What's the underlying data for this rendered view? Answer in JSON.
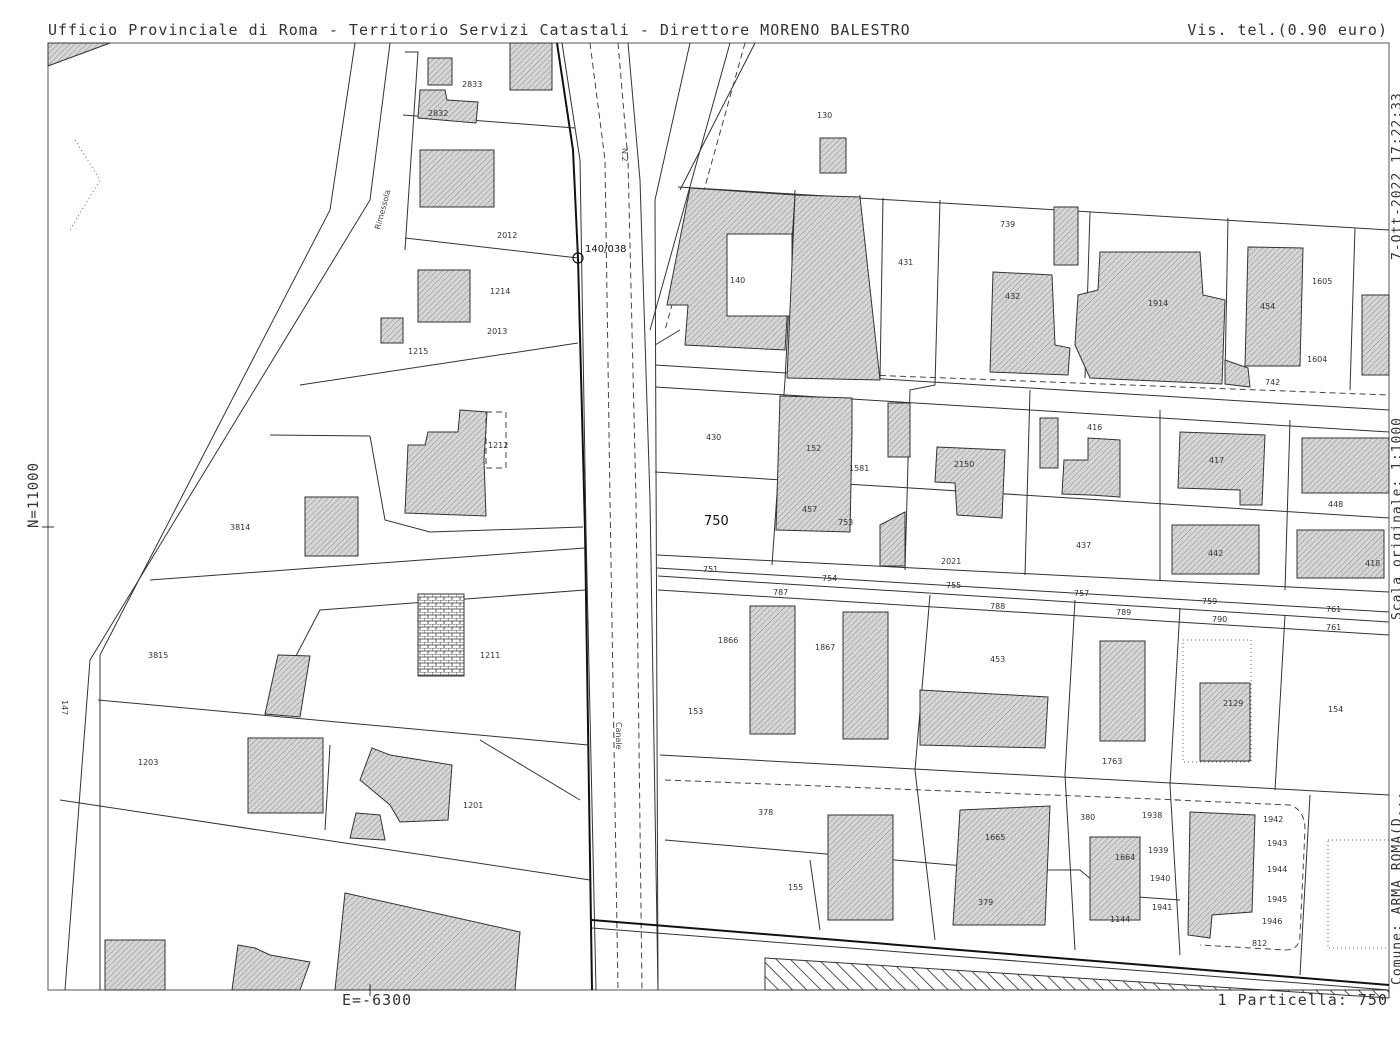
{
  "header": {
    "left": "Ufficio Provinciale di Roma - Territorio Servizi Catastali - Direttore MORENO BALESTRO",
    "right": "Vis. tel.(0.90 euro)"
  },
  "side": {
    "date": "7-Ott-2022 17:22:33",
    "scale": "Scala originale: 1:1000",
    "comune": "Comune: ARMA ROMA(D..."
  },
  "coords": {
    "north": "N=11000",
    "east": "E=-6300"
  },
  "footer": {
    "particella": "1 Particella: 750"
  },
  "control_point": "140/038",
  "streets": {
    "rimessola": "Rimessola",
    "n2": "N.2",
    "canale": "Canale",
    "fosso": "147"
  },
  "parcels": {
    "p2833": "2833",
    "p2832": "2832",
    "p2012": "2012",
    "p1214": "1214",
    "p2013": "2013",
    "p1215": "1215",
    "p1212": "1212",
    "p3814": "3814",
    "p1211": "1211",
    "p3815": "3815",
    "p1203": "1203",
    "p1201": "1201",
    "p130": "130",
    "p140": "140",
    "p431": "431",
    "p739": "739",
    "p432": "432",
    "p1914": "1914",
    "p454": "454",
    "p1605": "1605",
    "p1604": "1604",
    "p742": "742",
    "p430": "430",
    "p152": "152",
    "p1581": "1581",
    "p2150": "2150",
    "p416": "416",
    "p417": "417",
    "p448": "448",
    "p750": "750",
    "p457": "457",
    "p753": "753",
    "p437": "437",
    "p442": "442",
    "p2021": "2021",
    "p418": "418",
    "p751": "751",
    "p754": "754",
    "p755": "755",
    "p757": "757",
    "p787": "787",
    "p788": "788",
    "p789": "789",
    "p759": "759",
    "p790": "790",
    "p761a": "761",
    "p761b": "761",
    "p1866": "1866",
    "p1867": "1867",
    "p453": "453",
    "p153": "153",
    "p1763": "1763",
    "p2129": "2129",
    "p154": "154",
    "p378": "378",
    "p380": "380",
    "p1938": "1938",
    "p1942": "1942",
    "p1943": "1943",
    "p1665": "1665",
    "p1664": "1664",
    "p1939": "1939",
    "p1944": "1944",
    "p1940": "1940",
    "p1945": "1945",
    "p155": "155",
    "p379": "379",
    "p1941": "1941",
    "p1946": "1946",
    "p1144": "1144",
    "p812": "812"
  }
}
